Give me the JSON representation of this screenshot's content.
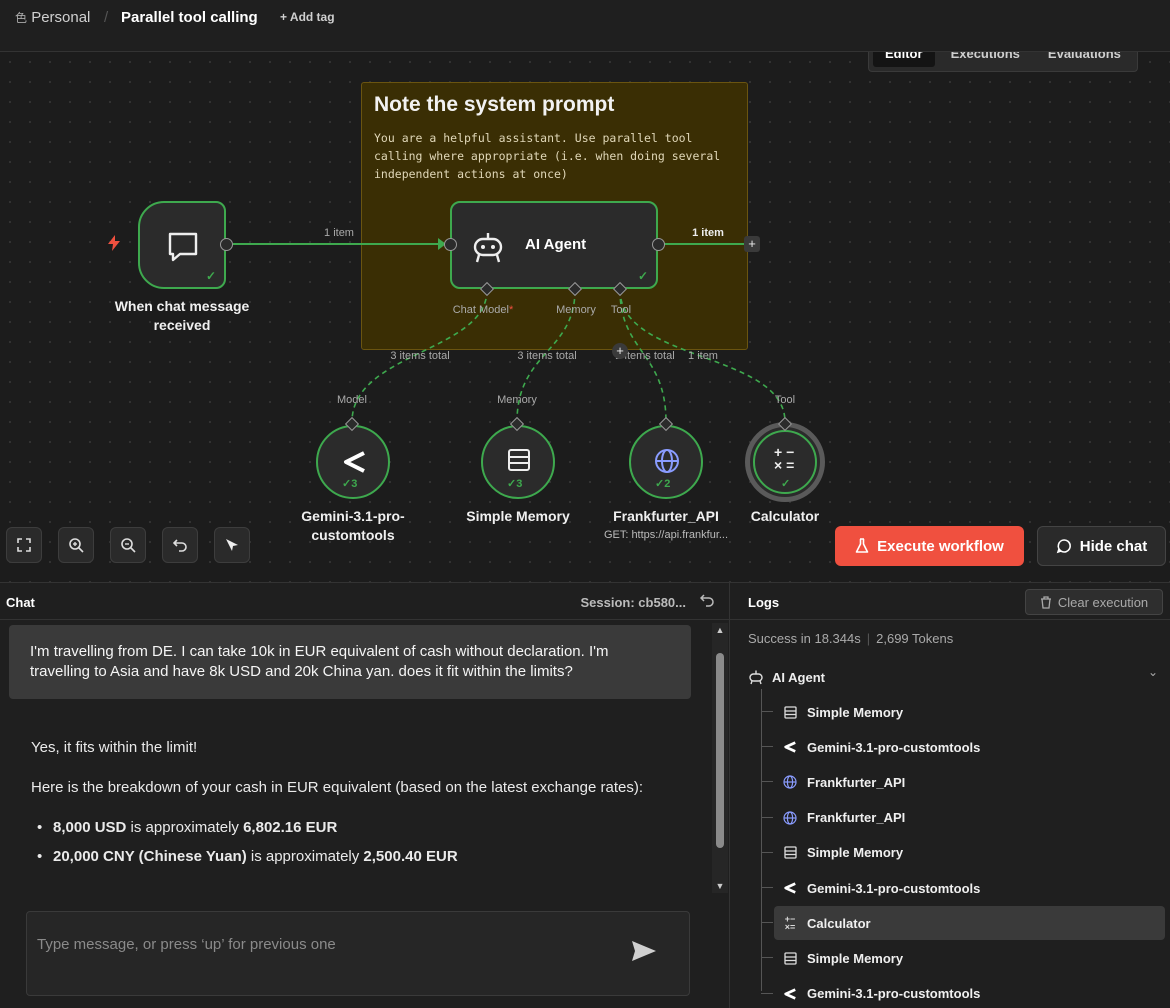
{
  "breadcrumb": {
    "owner": "Personal",
    "separator": "/",
    "title": "Parallel tool calling",
    "add_tag": "+ Add tag"
  },
  "view_tabs": [
    "Editor",
    "Executions",
    "Evaluations"
  ],
  "note": {
    "title": "Note the system prompt",
    "body": "You are a helpful assistant. Use parallel tool calling where appropriate (i.e. when doing several independent actions at once)"
  },
  "nodes": {
    "trigger": {
      "label": "When chat message received"
    },
    "agent": {
      "label": "AI Agent",
      "ports": {
        "chat_model": "Chat Model",
        "required_mark": "*",
        "memory": "Memory",
        "tool": "Tool"
      }
    },
    "gemini": {
      "label": "Gemini-3.1-pro-customtools",
      "count": "3",
      "conn_label": "Model"
    },
    "memory": {
      "label": "Simple Memory",
      "count": "3",
      "conn_label": "Memory"
    },
    "frankfurter": {
      "label": "Frankfurter_API",
      "count": "2",
      "sub": "GET: https://api.frankfur...",
      "conn_label": ""
    },
    "calculator": {
      "label": "Calculator",
      "conn_label": "Tool"
    }
  },
  "edges": {
    "trigger_to_agent": "1 item",
    "agent_out": "1 item",
    "model_items": "3 items total",
    "memory_items": "3 items total",
    "tool_items": "2 items total",
    "tool_items2": "1 item"
  },
  "actions": {
    "execute": "Execute workflow",
    "hide_chat": "Hide chat"
  },
  "chat": {
    "title": "Chat",
    "session": "Session: cb580...",
    "user_message": "I'm travelling from DE. I can take 10k in EUR equivalent of cash without declaration. I'm travelling to Asia and have 8k USD and 20k China yan. does it fit within the limits?",
    "ai_line1": "Yes, it fits within the limit!",
    "ai_line2": "Here is the breakdown of your cash in EUR equivalent (based on the latest exchange rates):",
    "bullets": [
      {
        "bold1": "8,000 USD",
        "mid": " is approximately ",
        "bold2": "6,802.16 EUR"
      },
      {
        "bold1": "20,000 CNY (Chinese Yuan)",
        "mid": " is approximately ",
        "bold2": "2,500.40 EUR"
      }
    ],
    "input_placeholder": "Type message, or press ‘up’ for previous one"
  },
  "logs": {
    "title": "Logs",
    "clear": "Clear execution",
    "status": "Success in 18.344s",
    "tokens": "2,699 Tokens",
    "root": "AI Agent",
    "entries": [
      {
        "label": "Simple Memory",
        "icon": "memory-icon"
      },
      {
        "label": "Gemini-3.1-pro-customtools",
        "icon": "model-icon"
      },
      {
        "label": "Frankfurter_API",
        "icon": "globe-icon"
      },
      {
        "label": "Frankfurter_API",
        "icon": "globe-icon"
      },
      {
        "label": "Simple Memory",
        "icon": "memory-icon"
      },
      {
        "label": "Gemini-3.1-pro-customtools",
        "icon": "model-icon"
      },
      {
        "label": "Calculator",
        "icon": "calculator-icon"
      },
      {
        "label": "Simple Memory",
        "icon": "memory-icon"
      },
      {
        "label": "Gemini-3.1-pro-customtools",
        "icon": "model-icon"
      }
    ],
    "selected_index": 6
  },
  "colors": {
    "success": "#3ea94e",
    "accent": "#f0503f",
    "note_bg": "#3a2e04"
  }
}
